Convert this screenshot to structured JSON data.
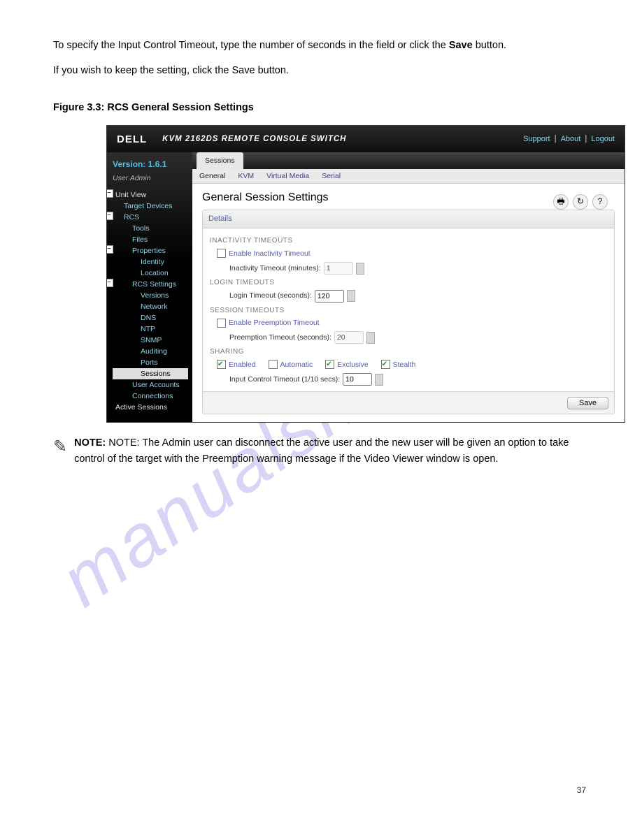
{
  "watermark": "manualshive.com",
  "doc": {
    "p1": "To specify the Input Control Timeout, type the number of seconds in the field or click the",
    "p2": "Save",
    "p3": " button.",
    "figcap": "Figure 3.3: RCS General Session Settings",
    "note": "NOTE: The Admin user can disconnect the active user and the new user will be given an option to take control of the target with the Preemption warning message if the Video Viewer window is open."
  },
  "shot": {
    "header": {
      "logo": "DELL",
      "title": "KVM 2162DS REMOTE CONSOLE SWITCH",
      "links": [
        "Support",
        "About",
        "Logout"
      ]
    },
    "left": {
      "version_label": "Version: 1.6.1",
      "user": "User Admin",
      "tree": [
        {
          "t": "Unit View",
          "lv": 0,
          "box": true
        },
        {
          "t": "Target Devices",
          "lv": 1
        },
        {
          "t": "RCS",
          "lv": 1,
          "box": true
        },
        {
          "t": "Tools",
          "lv": 2
        },
        {
          "t": "Files",
          "lv": 2
        },
        {
          "t": "Properties",
          "lv": 2,
          "box": true
        },
        {
          "t": "Identity",
          "lv": 3
        },
        {
          "t": "Location",
          "lv": 3
        },
        {
          "t": "RCS Settings",
          "lv": 2,
          "box": true
        },
        {
          "t": "Versions",
          "lv": 3
        },
        {
          "t": "Network",
          "lv": 3
        },
        {
          "t": "DNS",
          "lv": 3
        },
        {
          "t": "NTP",
          "lv": 3
        },
        {
          "t": "SNMP",
          "lv": 3
        },
        {
          "t": "Auditing",
          "lv": 3
        },
        {
          "t": "Ports",
          "lv": 3
        },
        {
          "t": "Sessions",
          "lv": 3,
          "sel": true
        },
        {
          "t": "User Accounts",
          "lv": 2
        },
        {
          "t": "Connections",
          "lv": 2
        },
        {
          "t": "Active Sessions",
          "lv": 0
        }
      ]
    },
    "tabs": {
      "main": "Sessions",
      "sub": [
        "General",
        "KVM",
        "Virtual Media",
        "Serial"
      ]
    },
    "content": {
      "heading": "General Session Settings",
      "box_title": "Details",
      "icons": [
        "🖶",
        "↻",
        "?"
      ],
      "sections": {
        "inactivity": {
          "title": "INACTIVITY TIMEOUTS",
          "chk_label": "Enable Inactivity Timeout",
          "chk": false,
          "field": "Inactivity Timeout (minutes):",
          "val": "1"
        },
        "login": {
          "title": "LOGIN TIMEOUTS",
          "field": "Login Timeout (seconds):",
          "val": "120"
        },
        "session": {
          "title": "SESSION TIMEOUTS",
          "chk_label": "Enable Preemption Timeout",
          "chk": false,
          "field": "Preemption Timeout (seconds):",
          "val": "20"
        },
        "sharing": {
          "title": "SHARING",
          "opts": [
            {
              "l": "Enabled",
              "c": true
            },
            {
              "l": "Automatic",
              "c": false
            },
            {
              "l": "Exclusive",
              "c": true
            },
            {
              "l": "Stealth",
              "c": true
            }
          ],
          "field": "Input Control Timeout (1/10 secs):",
          "val": "10"
        }
      },
      "save": "Save"
    }
  },
  "footer": "37"
}
